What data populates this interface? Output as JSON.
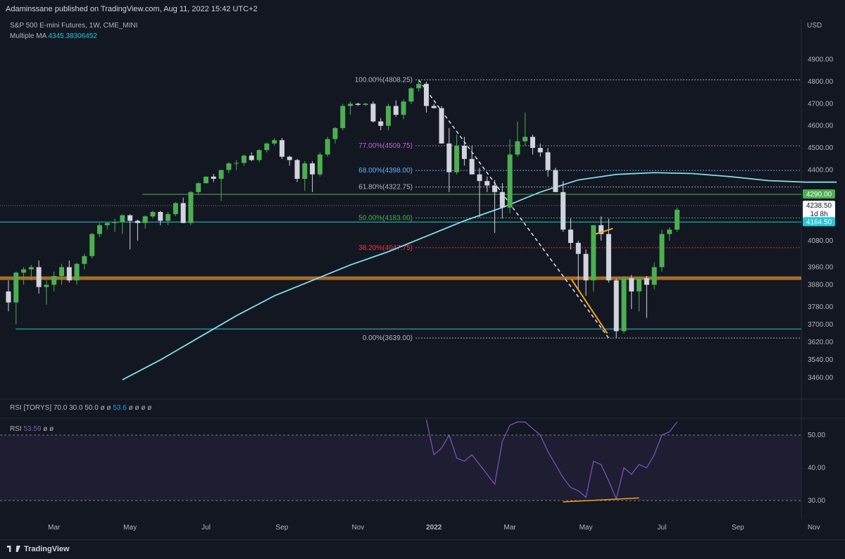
{
  "header": {
    "published": "Adaminssane published on TradingView.com, Aug 11, 2022 15:42 UTC+2"
  },
  "legend": {
    "symbol": "S&P 500 E-mini Futures, 1W, CME_MINI",
    "ma_label": "Multiple MA",
    "ma_value": "4345.38306452",
    "currency": "USD"
  },
  "rsi_panel": {
    "legend1_prefix": "RSI [TORYS] 70.0 30.0 50.0 ø ø",
    "legend1_value": "53.6",
    "legend1_suffix": "ø ø ø ø",
    "legend2_prefix": "RSI",
    "legend2_value": "53.59",
    "legend2_suffix": "ø ø"
  },
  "footer": {
    "logo": "TradingView"
  },
  "colors": {
    "background": "#131722",
    "bull": "#4caf50",
    "bear": "#d1d4dc",
    "ma": "#80deea",
    "rsi": "#7e57c2",
    "support": "#b8782a",
    "fib_green": "#4caf50",
    "fib_red": "#f23645"
  },
  "chart_data": {
    "type": "candlestick",
    "title": "S&P 500 E-mini Futures, 1W, CME_MINI",
    "ylabel": "USD",
    "ylim": [
      3380,
      4960
    ],
    "y_ticks": [
      3460,
      3540,
      3620,
      3700,
      3780,
      3880,
      3960,
      4080,
      4400,
      4500,
      4600,
      4700,
      4800,
      4900
    ],
    "x_ticks": [
      "Mar",
      "May",
      "Jul",
      "Sep",
      "Nov",
      "2022",
      "Mar",
      "May",
      "Jul",
      "Sep",
      "Nov"
    ],
    "x_tick_week": [
      6,
      16,
      26,
      36,
      46,
      56,
      66,
      76,
      86,
      96,
      106
    ],
    "candles": [
      [
        3850,
        3900,
        3760,
        3800
      ],
      [
        3800,
        3940,
        3700,
        3935
      ],
      [
        3935,
        3960,
        3880,
        3950
      ],
      [
        3950,
        3970,
        3900,
        3960
      ],
      [
        3960,
        3990,
        3840,
        3870
      ],
      [
        3870,
        3900,
        3790,
        3880
      ],
      [
        3880,
        3940,
        3850,
        3920
      ],
      [
        3920,
        3975,
        3880,
        3960
      ],
      [
        3960,
        3990,
        3890,
        3900
      ],
      [
        3900,
        3980,
        3880,
        3975
      ],
      [
        3975,
        4020,
        3950,
        4010
      ],
      [
        4010,
        4115,
        4000,
        4110
      ],
      [
        4110,
        4160,
        4095,
        4150
      ],
      [
        4150,
        4165,
        4130,
        4160
      ],
      [
        4160,
        4180,
        4120,
        4165
      ],
      [
        4165,
        4200,
        4110,
        4195
      ],
      [
        4195,
        4200,
        4040,
        4170
      ],
      [
        4170,
        4175,
        4080,
        4160
      ],
      [
        4160,
        4195,
        4135,
        4190
      ],
      [
        4190,
        4215,
        4180,
        4210
      ],
      [
        4210,
        4215,
        4150,
        4170
      ],
      [
        4170,
        4210,
        4150,
        4200
      ],
      [
        4200,
        4255,
        4190,
        4250
      ],
      [
        4250,
        4275,
        4160,
        4160
      ],
      [
        4160,
        4305,
        4150,
        4300
      ],
      [
        4300,
        4345,
        4290,
        4340
      ],
      [
        4340,
        4370,
        4340,
        4370
      ],
      [
        4370,
        4382,
        4345,
        4360
      ],
      [
        4360,
        4400,
        4260,
        4400
      ],
      [
        4400,
        4435,
        4385,
        4430
      ],
      [
        4430,
        4445,
        4400,
        4432
      ],
      [
        4432,
        4470,
        4420,
        4465
      ],
      [
        4465,
        4480,
        4440,
        4445
      ],
      [
        4445,
        4495,
        4435,
        4490
      ],
      [
        4490,
        4525,
        4480,
        4520
      ],
      [
        4520,
        4545,
        4510,
        4535
      ],
      [
        4535,
        4545,
        4450,
        4460
      ],
      [
        4460,
        4465,
        4420,
        4445
      ],
      [
        4445,
        4450,
        4345,
        4360
      ],
      [
        4360,
        4440,
        4305,
        4430
      ],
      [
        4430,
        4440,
        4300,
        4380
      ],
      [
        4380,
        4480,
        4370,
        4470
      ],
      [
        4470,
        4550,
        4460,
        4540
      ],
      [
        4540,
        4595,
        4520,
        4590
      ],
      [
        4590,
        4700,
        4580,
        4690
      ],
      [
        4690,
        4710,
        4650,
        4700
      ],
      [
        4700,
        4705,
        4690,
        4695
      ],
      [
        4695,
        4705,
        4690,
        4700
      ],
      [
        4700,
        4710,
        4615,
        4620
      ],
      [
        4620,
        4635,
        4580,
        4600
      ],
      [
        4600,
        4700,
        4580,
        4690
      ],
      [
        4690,
        4715,
        4640,
        4650
      ],
      [
        4650,
        4720,
        4630,
        4710
      ],
      [
        4710,
        4775,
        4700,
        4770
      ],
      [
        4770,
        4808,
        4755,
        4790
      ],
      [
        4790,
        4800,
        4660,
        4690
      ],
      [
        4690,
        4700,
        4680,
        4680
      ],
      [
        4680,
        4690,
        4520,
        4520
      ],
      [
        4520,
        4590,
        4300,
        4390
      ],
      [
        4390,
        4560,
        4380,
        4510
      ],
      [
        4510,
        4550,
        4420,
        4450
      ],
      [
        4450,
        4510,
        4380,
        4380
      ],
      [
        4380,
        4410,
        4185,
        4350
      ],
      [
        4350,
        4370,
        4300,
        4330
      ],
      [
        4330,
        4355,
        4115,
        4300
      ],
      [
        4300,
        4340,
        4180,
        4230
      ],
      [
        4230,
        4540,
        4205,
        4470
      ],
      [
        4470,
        4620,
        4460,
        4530
      ],
      [
        4530,
        4660,
        4510,
        4550
      ],
      [
        4550,
        4560,
        4470,
        4500
      ],
      [
        4500,
        4520,
        4460,
        4480
      ],
      [
        4480,
        4500,
        4370,
        4400
      ],
      [
        4400,
        4410,
        4300,
        4300
      ],
      [
        4300,
        4350,
        4120,
        4130
      ],
      [
        4130,
        4180,
        4040,
        4070
      ],
      [
        4070,
        4080,
        3855,
        4020
      ],
      [
        4020,
        4040,
        3830,
        3900
      ],
      [
        3900,
        4150,
        3850,
        4150
      ],
      [
        4150,
        4190,
        4080,
        4110
      ],
      [
        4110,
        4180,
        3890,
        3900
      ],
      [
        3900,
        3910,
        3640,
        3670
      ],
      [
        3670,
        3920,
        3660,
        3910
      ],
      [
        3910,
        3925,
        3770,
        3850
      ],
      [
        3850,
        3910,
        3760,
        3910
      ],
      [
        3910,
        3920,
        3730,
        3880
      ],
      [
        3880,
        3980,
        3860,
        3960
      ],
      [
        3960,
        4130,
        3940,
        4110
      ],
      [
        4110,
        4140,
        4080,
        4130
      ],
      [
        4130,
        4230,
        4120,
        4220
      ]
    ],
    "moving_average": [
      [
        15,
        3450
      ],
      [
        20,
        3540
      ],
      [
        25,
        3640
      ],
      [
        30,
        3740
      ],
      [
        35,
        3830
      ],
      [
        40,
        3900
      ],
      [
        45,
        3970
      ],
      [
        50,
        4030
      ],
      [
        55,
        4100
      ],
      [
        60,
        4170
      ],
      [
        65,
        4230
      ],
      [
        70,
        4300
      ],
      [
        75,
        4355
      ],
      [
        80,
        4380
      ],
      [
        85,
        4388
      ],
      [
        90,
        4384
      ],
      [
        95,
        4370
      ],
      [
        100,
        4352
      ],
      [
        105,
        4345
      ],
      [
        109,
        4345
      ]
    ],
    "price_lines": [
      {
        "label": "4290.00",
        "value": 4290
      },
      {
        "label": "4238.50",
        "value": 4238.5,
        "sublabel": "1d 8h"
      },
      {
        "label": "4164.50",
        "value": 4164.5
      }
    ],
    "horizontal_levels": [
      {
        "value": 4290,
        "style": "solid",
        "color": "#4caf50"
      },
      {
        "value": 4164.5,
        "style": "solid",
        "color": "#26c6da"
      },
      {
        "value": 3910,
        "style": "thick",
        "color": "#b8782a"
      },
      {
        "value": 3680,
        "style": "solid",
        "color": "#26c6da"
      }
    ],
    "fibonacci": [
      {
        "label": "100.00%(4808.25)",
        "value": 4808.25,
        "color": "#b2b5be"
      },
      {
        "label": "77.00%(4509.75)",
        "value": 4509.75,
        "color": "#ba68c8"
      },
      {
        "label": "68.00%(4398.00)",
        "value": 4398,
        "color": "#64b5f6"
      },
      {
        "label": "61.80%(4322.75)",
        "value": 4322.75,
        "color": "#b2b5be"
      },
      {
        "label": "50.00%(4183.00)",
        "value": 4183,
        "color": "#4caf50"
      },
      {
        "label": "38.20%(4047.75)",
        "value": 4047.75,
        "color": "#f23645"
      },
      {
        "label": "0.00%(3639.00)",
        "value": 3639,
        "color": "#b2b5be"
      }
    ],
    "rsi": {
      "ylim": [
        27,
        57
      ],
      "y_ticks": [
        30.0,
        40.0,
        50.0
      ],
      "values": [
        [
          55,
          56
        ],
        [
          56,
          44
        ],
        [
          57,
          46
        ],
        [
          58,
          50
        ],
        [
          59,
          43
        ],
        [
          60,
          42
        ],
        [
          61,
          44
        ],
        [
          62,
          41
        ],
        [
          63,
          38
        ],
        [
          64,
          35
        ],
        [
          65,
          48
        ],
        [
          66,
          53
        ],
        [
          67,
          54
        ],
        [
          68,
          54
        ],
        [
          69,
          52
        ],
        [
          70,
          50
        ],
        [
          71,
          45
        ],
        [
          72,
          41
        ],
        [
          73,
          37
        ],
        [
          74,
          34
        ],
        [
          75,
          33
        ],
        [
          76,
          31
        ],
        [
          77,
          42
        ],
        [
          78,
          41
        ],
        [
          79,
          36
        ],
        [
          80,
          30.5
        ],
        [
          81,
          40
        ],
        [
          82,
          38
        ],
        [
          83,
          41
        ],
        [
          84,
          40
        ],
        [
          85,
          44
        ],
        [
          86,
          50
        ],
        [
          87,
          51
        ],
        [
          88,
          54
        ]
      ],
      "last": "53.59"
    }
  }
}
